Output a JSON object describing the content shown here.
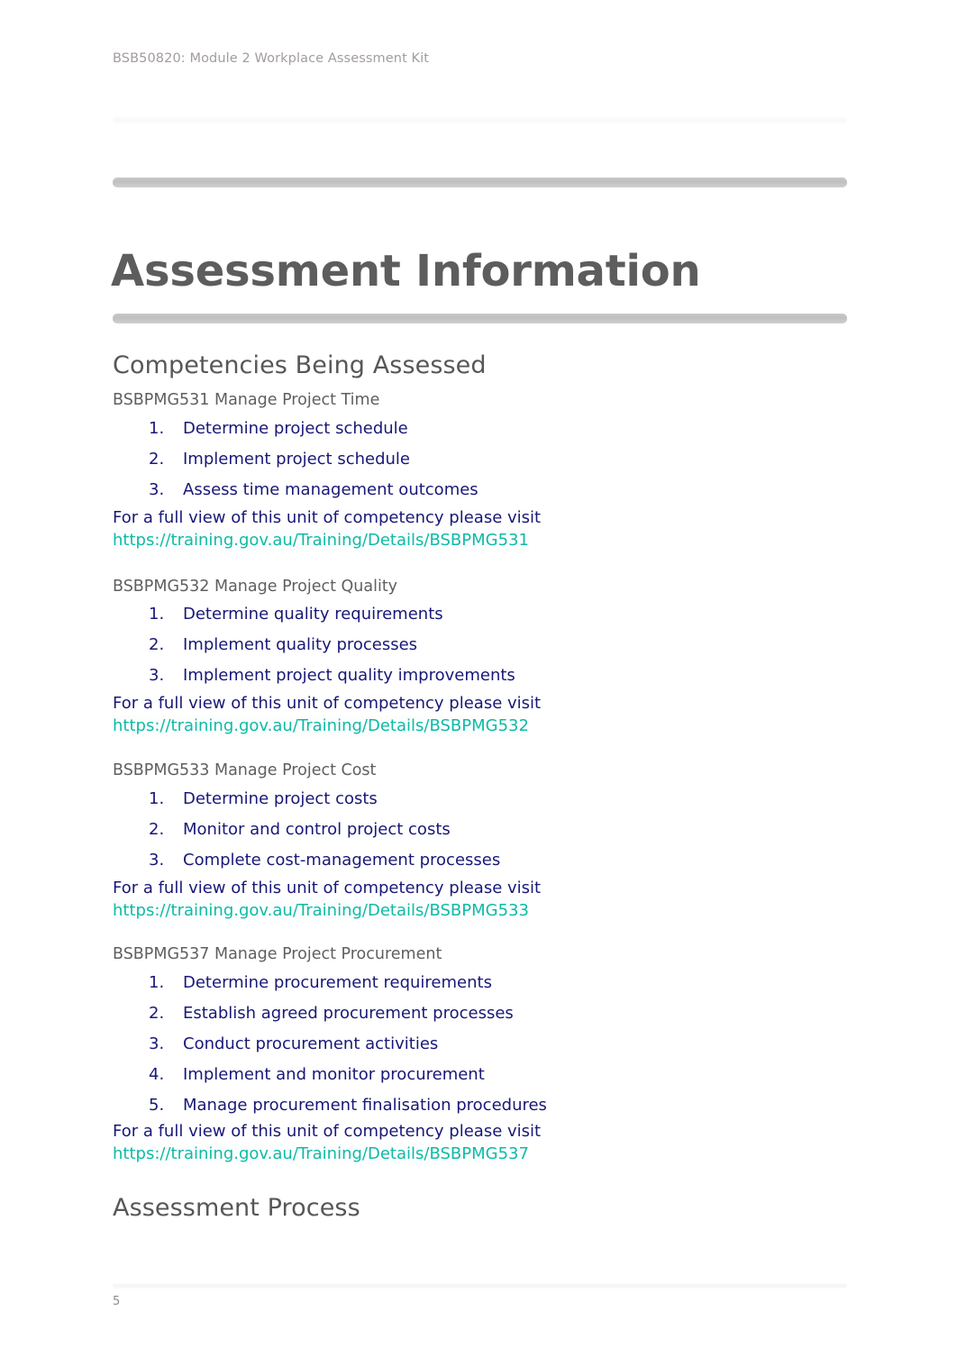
{
  "document": {
    "running_header": "BSB50820: Module 2 Workplace Assessment Kit",
    "title": "Assessment Information",
    "page_number": "5"
  },
  "colors": {
    "title_gray": "#5d5d5d",
    "heading_gray": "#575757",
    "unit_title_gray": "#5f5f5f",
    "list_navy": "#181878",
    "link_teal": "#0fbaa6",
    "rule_gray": "#bfbfbf",
    "header_text": "#a39c9c"
  },
  "sections": {
    "competencies": {
      "heading": "Competencies Being Assessed",
      "visit_prefix": "For a full view of this unit of competency please visit",
      "units": [
        {
          "code_title": "BSBPMG531 Manage Project Time",
          "elements": [
            "Determine project schedule",
            "Implement project schedule",
            "Assess time management outcomes"
          ],
          "url": "https://training.gov.au/Training/Details/BSBPMG531"
        },
        {
          "code_title": "BSBPMG532 Manage Project Quality",
          "elements": [
            "Determine quality requirements",
            "Implement quality processes",
            "Implement project quality improvements"
          ],
          "url": "https://training.gov.au/Training/Details/BSBPMG532"
        },
        {
          "code_title": "BSBPMG533 Manage Project Cost",
          "elements": [
            "Determine project costs",
            "Monitor and control project costs",
            "Complete cost-management processes"
          ],
          "url": "https://training.gov.au/Training/Details/BSBPMG533"
        },
        {
          "code_title": "BSBPMG537 Manage Project Procurement",
          "elements": [
            "Determine procurement requirements",
            "Establish agreed procurement processes",
            "Conduct procurement activities",
            "Implement and monitor procurement",
            "Manage procurement finalisation procedures"
          ],
          "url": "https://training.gov.au/Training/Details/BSBPMG537"
        }
      ]
    },
    "assessment_process": {
      "heading": "Assessment Process"
    }
  }
}
